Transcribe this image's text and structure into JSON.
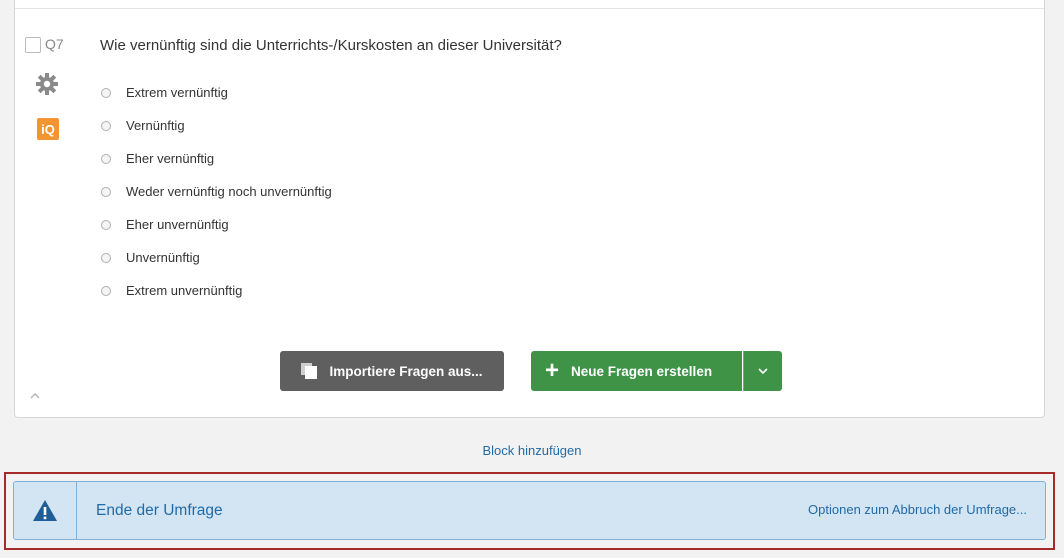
{
  "question": {
    "number": "Q7",
    "text": "Wie vernünftig sind die Unterrichts-/Kurskosten an dieser Universität?",
    "iq_badge": "iQ",
    "choices": [
      {
        "label": "Extrem vernünftig"
      },
      {
        "label": "Vernünftig"
      },
      {
        "label": "Eher vernünftig"
      },
      {
        "label": "Weder vernünftig noch unvernünftig"
      },
      {
        "label": "Eher unvernünftig"
      },
      {
        "label": "Unvernünftig"
      },
      {
        "label": "Extrem unvernünftig"
      }
    ]
  },
  "actions": {
    "import_label": "Importiere Fragen aus...",
    "new_label": "Neue Fragen erstellen",
    "new_plus": "+"
  },
  "add_block_label": "Block hinzufügen",
  "end_of_survey": {
    "title": "Ende der Umfrage",
    "options_link": "Optionen zum Abbruch der Umfrage..."
  },
  "icons": {
    "settings": "gear-icon",
    "import": "copy-pages-icon",
    "dropdown": "chevron-down-icon",
    "collapse": "chevron-up-icon",
    "warning": "warning-triangle-icon"
  },
  "colors": {
    "primary_green": "#3e9347",
    "import_gray": "#5f5f5f",
    "link_blue": "#1f6aa8",
    "iq_orange": "#f39631",
    "end_bar_bg": "#d3e5f3",
    "highlight_red": "#a62a2a"
  }
}
